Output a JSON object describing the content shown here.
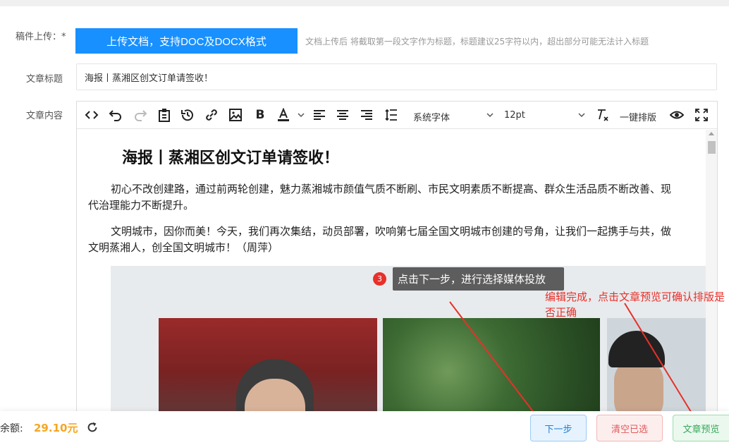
{
  "form": {
    "upload_label": "稿件上传：",
    "required_mark": "*",
    "upload_button": "上传文档，支持DOC及DOCX格式",
    "upload_hint": "文档上传后 将截取第一段文字作为标题，标题建议25字符以内，超出部分可能无法计入标题",
    "title_label": "文章标题",
    "title_value": "海报丨蒸湘区创文订单请签收！",
    "content_label": "文章内容"
  },
  "toolbar": {
    "icons": [
      "code-icon",
      "undo-icon",
      "redo-icon",
      "paste-icon",
      "history-icon",
      "link-icon",
      "image-icon",
      "bold-icon",
      "font-color-icon",
      "align-left-icon",
      "align-center-icon",
      "align-right-icon",
      "line-height-icon",
      "clear-format-icon",
      "preview-eye-icon",
      "fullscreen-icon"
    ],
    "font_family": "系统字体",
    "font_size": "12pt",
    "one_click_layout": "一键排版"
  },
  "article": {
    "title": "海报丨蒸湘区创文订单请签收！",
    "paragraph_1": "初心不改创建路，通过前两轮创建，魅力蒸湘城市颜值气质不断刷、市民文明素质不断提高、群众生活品质不断改善、现代治理能力不断提升。",
    "paragraph_2": "文明城市，因你而美！今天，我们再次集结，动员部署，吹响第七届全国文明城市创建的号角，让我们一起携手与共，做文明蒸湘人，创全国文明城市！（周萍）"
  },
  "guide": {
    "step_number": "3",
    "tooltip": "点击下一步，进行选择媒体投放",
    "annotation": "编辑完成，点击文章预览可确认排版是否正确",
    "accent_color": "#e8302a"
  },
  "footer": {
    "balance_label": "余额:",
    "balance_value": "29.10元",
    "next_button": "下一步",
    "clear_button": "清空已选",
    "preview_button": "文章预览"
  }
}
